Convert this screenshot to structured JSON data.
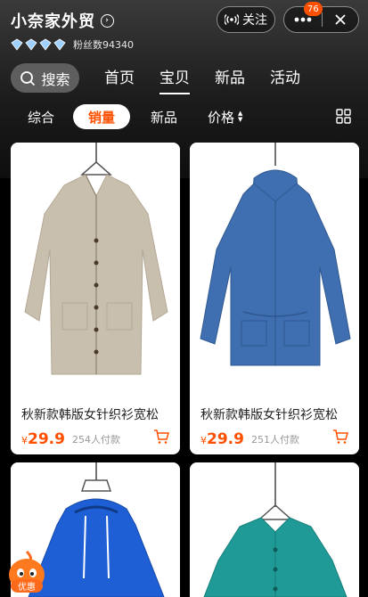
{
  "shop": {
    "name": "小奈家外贸",
    "fans": "粉丝数94340",
    "follow_label": "关注",
    "notification_count": "76"
  },
  "main_nav": {
    "search_label": "搜索",
    "items": [
      "首页",
      "宝贝",
      "新品",
      "活动"
    ],
    "active": "宝贝"
  },
  "sub_nav": {
    "items": [
      "综合",
      "销量",
      "新品",
      "价格"
    ],
    "active": "销量"
  },
  "products": [
    {
      "title": "秋新款韩版女针织衫宽松",
      "price_symbol": "¥",
      "price": "29.9",
      "sales": "254人付款",
      "color": "#c9bfae"
    },
    {
      "title": "秋新款韩版女针织衫宽松",
      "price_symbol": "¥",
      "price": "29.9",
      "sales": "251人付款",
      "color": "#3f6fb0"
    },
    {
      "title": "",
      "price_symbol": "",
      "price": "",
      "sales": "",
      "color": "#1e5fd6"
    },
    {
      "title": "",
      "price_symbol": "",
      "price": "",
      "sales": "",
      "color": "#1f9a96"
    }
  ],
  "promo": {
    "label": "优惠"
  },
  "colors": {
    "accent": "#ff5000"
  }
}
